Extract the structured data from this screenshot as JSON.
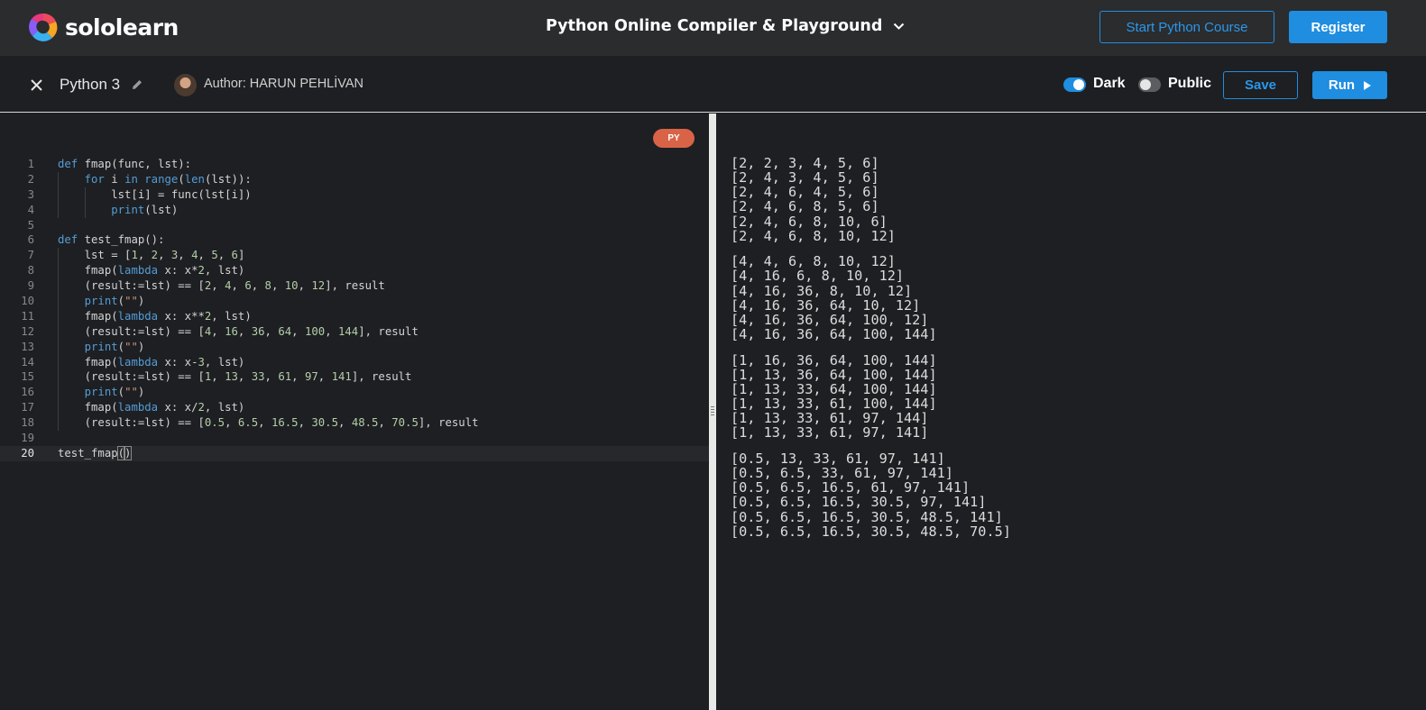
{
  "brand": {
    "name": "sololearn"
  },
  "header": {
    "title": "Python Online Compiler & Playground",
    "course_button": "Start Python Course",
    "register_button": "Register"
  },
  "toolbar": {
    "language": "Python 3",
    "author": "Author: HARUN PEHLİVAN",
    "dark_label": "Dark",
    "dark_on": true,
    "public_label": "Public",
    "public_on": false,
    "save_label": "Save",
    "run_label": "Run"
  },
  "editor": {
    "badge": "PY",
    "active_line": 20,
    "lines": [
      {
        "n": "1",
        "t": "def fmap(func, lst):"
      },
      {
        "n": "2",
        "t": "    for i in range(len(lst)):"
      },
      {
        "n": "3",
        "t": "        lst[i] = func(lst[i])"
      },
      {
        "n": "4",
        "t": "        print(lst)"
      },
      {
        "n": "5",
        "t": ""
      },
      {
        "n": "6",
        "t": "def test_fmap():"
      },
      {
        "n": "7",
        "t": "    lst = [1, 2, 3, 4, 5, 6]"
      },
      {
        "n": "8",
        "t": "    fmap(lambda x: x*2, lst)"
      },
      {
        "n": "9",
        "t": "    (result:=lst) == [2, 4, 6, 8, 10, 12], result"
      },
      {
        "n": "10",
        "t": "    print(\"\")"
      },
      {
        "n": "11",
        "t": "    fmap(lambda x: x**2, lst)"
      },
      {
        "n": "12",
        "t": "    (result:=lst) == [4, 16, 36, 64, 100, 144], result"
      },
      {
        "n": "13",
        "t": "    print(\"\")"
      },
      {
        "n": "14",
        "t": "    fmap(lambda x: x-3, lst)"
      },
      {
        "n": "15",
        "t": "    (result:=lst) == [1, 13, 33, 61, 97, 141], result"
      },
      {
        "n": "16",
        "t": "    print(\"\")"
      },
      {
        "n": "17",
        "t": "    fmap(lambda x: x/2, lst)"
      },
      {
        "n": "18",
        "t": "    (result:=lst) == [0.5, 6.5, 16.5, 30.5, 48.5, 70.5], result"
      },
      {
        "n": "19",
        "t": ""
      },
      {
        "n": "20",
        "t": "test_fmap()"
      }
    ]
  },
  "output": {
    "lines": [
      "[2, 2, 3, 4, 5, 6]",
      "[2, 4, 3, 4, 5, 6]",
      "[2, 4, 6, 4, 5, 6]",
      "[2, 4, 6, 8, 5, 6]",
      "[2, 4, 6, 8, 10, 6]",
      "[2, 4, 6, 8, 10, 12]",
      "",
      "[4, 4, 6, 8, 10, 12]",
      "[4, 16, 6, 8, 10, 12]",
      "[4, 16, 36, 8, 10, 12]",
      "[4, 16, 36, 64, 10, 12]",
      "[4, 16, 36, 64, 100, 12]",
      "[4, 16, 36, 64, 100, 144]",
      "",
      "[1, 16, 36, 64, 100, 144]",
      "[1, 13, 36, 64, 100, 144]",
      "[1, 13, 33, 64, 100, 144]",
      "[1, 13, 33, 61, 100, 144]",
      "[1, 13, 33, 61, 97, 144]",
      "[1, 13, 33, 61, 97, 141]",
      "",
      "[0.5, 13, 33, 61, 97, 141]",
      "[0.5, 6.5, 33, 61, 97, 141]",
      "[0.5, 6.5, 16.5, 61, 97, 141]",
      "[0.5, 6.5, 16.5, 30.5, 97, 141]",
      "[0.5, 6.5, 16.5, 30.5, 48.5, 141]",
      "[0.5, 6.5, 16.5, 30.5, 48.5, 70.5]"
    ]
  },
  "colors": {
    "accent": "#1f8de0",
    "badge": "#d96347",
    "keyword": "#569cd6",
    "number": "#b5cea8",
    "string": "#ce9178"
  }
}
